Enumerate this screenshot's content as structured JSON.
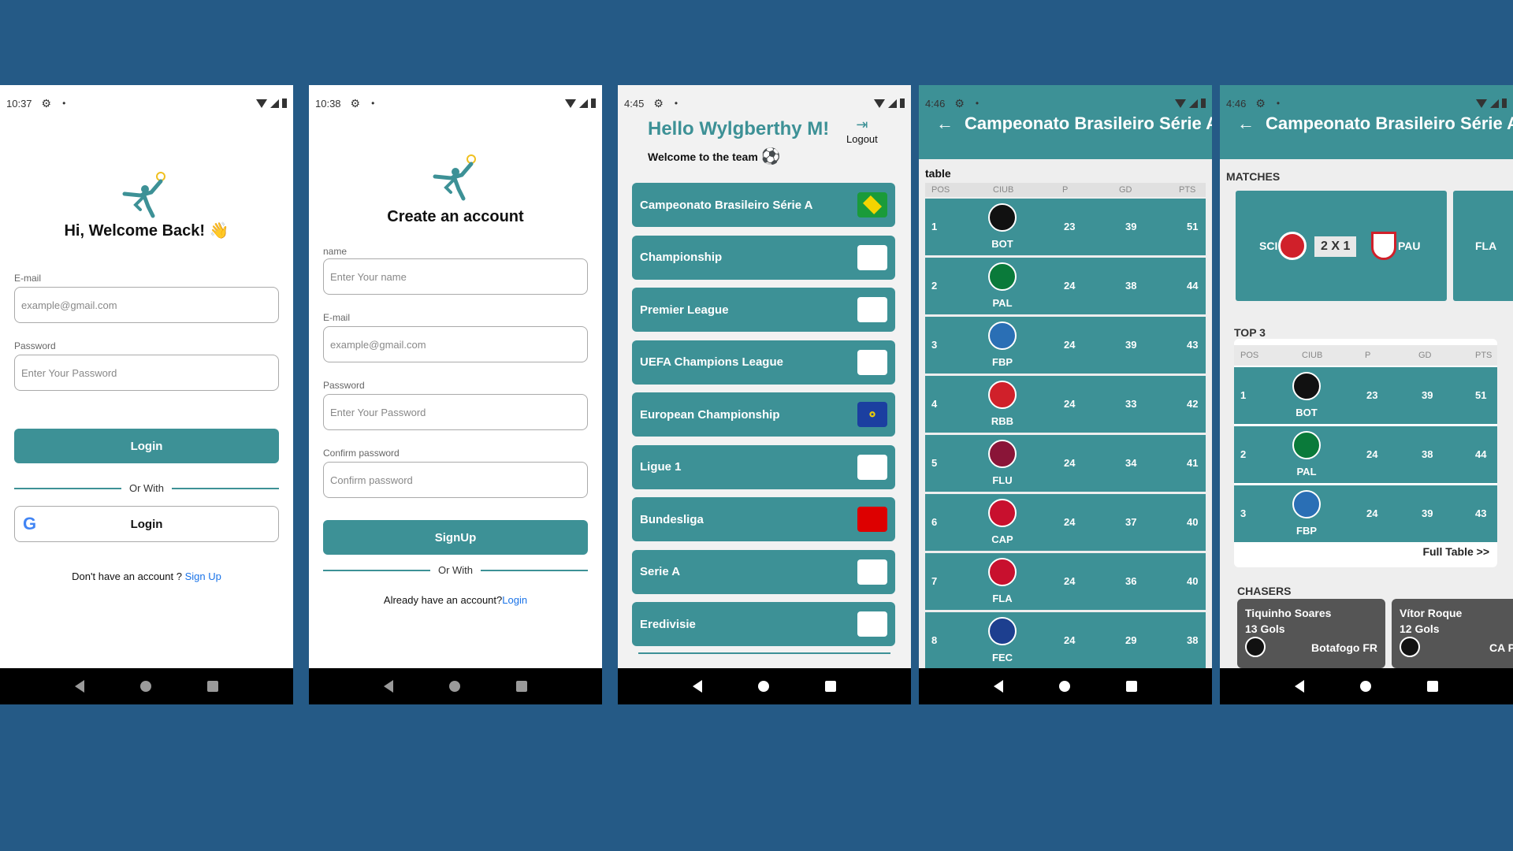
{
  "colors": {
    "background": "#255a86",
    "teal": "#3d9196",
    "link": "#1a73e8"
  },
  "screen1": {
    "time": "10:37",
    "title": "Hi, Welcome Back! 👋",
    "email_label": "E-mail",
    "email_placeholder": "example@gmail.com",
    "password_label": "Password",
    "password_placeholder": "Enter Your Password",
    "login_button": "Login",
    "or_with": "Or With",
    "google_login": "Login",
    "no_account": "Don't have an account ?",
    "sign_up_link": "Sign Up"
  },
  "screen2": {
    "time": "10:38",
    "title": "Create an account",
    "name_label": "name",
    "name_placeholder": "Enter Your name",
    "email_label": "E-mail",
    "email_placeholder": "example@gmail.com",
    "password_label": "Password",
    "password_placeholder": "Enter Your Password",
    "confirm_label": "Confirm password",
    "confirm_placeholder": "Confirm password",
    "signup_button": "SignUp",
    "or_with": "Or With",
    "have_account": "Already have an account?",
    "login_link": "Login"
  },
  "screen3": {
    "time": "4:45",
    "greeting": "Hello Wylgberthy M!",
    "subtitle": "Welcome to the team",
    "logout": "Logout",
    "leagues": [
      {
        "name": "Campeonato Brasileiro Série A",
        "badge": "brazil-flag-icon"
      },
      {
        "name": "Championship",
        "badge": "sky-bet-efl-icon"
      },
      {
        "name": "Premier League",
        "badge": "premier-league-icon"
      },
      {
        "name": "UEFA Champions League",
        "badge": "champions-league-icon"
      },
      {
        "name": "European Championship",
        "badge": "eu-flag-icon"
      },
      {
        "name": "Ligue 1",
        "badge": "ligue1-icon"
      },
      {
        "name": "Bundesliga",
        "badge": "bundesliga-icon"
      },
      {
        "name": "Serie A",
        "badge": "serie-a-icon"
      },
      {
        "name": "Eredivisie",
        "badge": "eredivisie-icon"
      }
    ]
  },
  "screen4": {
    "time": "4:46",
    "title": "Campeonato Brasileiro Série A",
    "section": "table",
    "headers": [
      "POS",
      "CIUB",
      "P",
      "GD",
      "PTS"
    ],
    "rows": [
      {
        "pos": "1",
        "club": "BOT",
        "p": "23",
        "gd": "39",
        "pts": "51",
        "color": "#111111"
      },
      {
        "pos": "2",
        "club": "PAL",
        "p": "24",
        "gd": "38",
        "pts": "44",
        "color": "#0a7a3a"
      },
      {
        "pos": "3",
        "club": "FBP",
        "p": "24",
        "gd": "39",
        "pts": "43",
        "color": "#2a6fb5"
      },
      {
        "pos": "4",
        "club": "RBB",
        "p": "24",
        "gd": "33",
        "pts": "42",
        "color": "#d0202a"
      },
      {
        "pos": "5",
        "club": "FLU",
        "p": "24",
        "gd": "34",
        "pts": "41",
        "color": "#8a1538"
      },
      {
        "pos": "6",
        "club": "CAP",
        "p": "24",
        "gd": "37",
        "pts": "40",
        "color": "#c8102e"
      },
      {
        "pos": "7",
        "club": "FLA",
        "p": "24",
        "gd": "36",
        "pts": "40",
        "color": "#c8102e"
      },
      {
        "pos": "8",
        "club": "FEC",
        "p": "24",
        "gd": "29",
        "pts": "38",
        "color": "#1d3f8f"
      }
    ]
  },
  "screen5": {
    "time": "4:46",
    "title": "Campeonato Brasileiro Série A",
    "matches_label": "MATCHES",
    "match": {
      "home": "SCI",
      "score": "2 X 1",
      "away": "PAU"
    },
    "next_match_home": "FLA",
    "top3_label": "TOP 3",
    "headers": [
      "POS",
      "CIUB",
      "P",
      "GD",
      "PTS"
    ],
    "rows": [
      {
        "pos": "1",
        "club": "BOT",
        "p": "23",
        "gd": "39",
        "pts": "51",
        "color": "#111111"
      },
      {
        "pos": "2",
        "club": "PAL",
        "p": "24",
        "gd": "38",
        "pts": "44",
        "color": "#0a7a3a"
      },
      {
        "pos": "3",
        "club": "FBP",
        "p": "24",
        "gd": "39",
        "pts": "43",
        "color": "#2a6fb5"
      }
    ],
    "full_table": "Full Table >>",
    "chasers_label": "CHASERS",
    "chasers": [
      {
        "name": "Tiquinho Soares",
        "goals": "13 Gols",
        "team": "Botafogo FR"
      },
      {
        "name": "Vítor Roque",
        "goals": "12 Gols",
        "team": "CA Para"
      }
    ]
  }
}
